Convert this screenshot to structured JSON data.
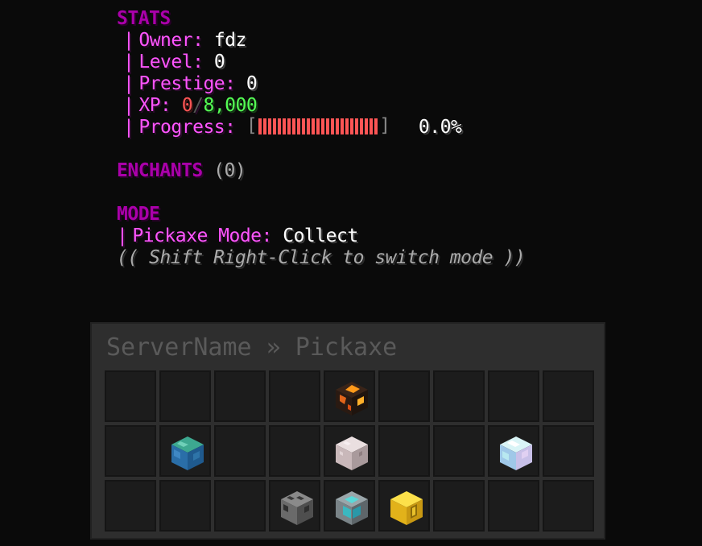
{
  "stats": {
    "title": "STATS",
    "owner_label": "Owner:",
    "owner_value": "fdz",
    "level_label": "Level:",
    "level_value": "0",
    "prestige_label": "Prestige:",
    "prestige_value": "0",
    "xp_label": "XP:",
    "xp_current": "0",
    "xp_separator": "/",
    "xp_max": "8,000",
    "progress_label": "Progress:",
    "progress_fraction": 0.0,
    "progress_text": "0.0%",
    "bracket_open": "[",
    "bracket_close": "]"
  },
  "enchants": {
    "title": "ENCHANTS",
    "count": "(0)"
  },
  "mode": {
    "title": "MODE",
    "label": "Pickaxe Mode:",
    "value": "Collect",
    "hint": "(( Shift Right-Click to switch mode ))"
  },
  "separator": "|",
  "gui": {
    "title": "ServerName » Pickaxe",
    "rows": [
      [
        "",
        "",
        "",
        "",
        "magma-block-icon",
        "",
        "",
        "",
        ""
      ],
      [
        "",
        "prismarine-block-icon",
        "",
        "",
        "diorite-block-icon",
        "",
        "",
        "diamond-block-icon",
        ""
      ],
      [
        "",
        "",
        "",
        "iron-ore-block-icon",
        "beacon-block-icon",
        "gold-block-icon",
        "",
        "",
        ""
      ]
    ]
  },
  "colors": {
    "pink": "#ff55ff",
    "purple": "#aa00aa",
    "red": "#ff5555",
    "green": "#55ff55",
    "white": "#ffffff",
    "gray": "#aaaaaa"
  }
}
